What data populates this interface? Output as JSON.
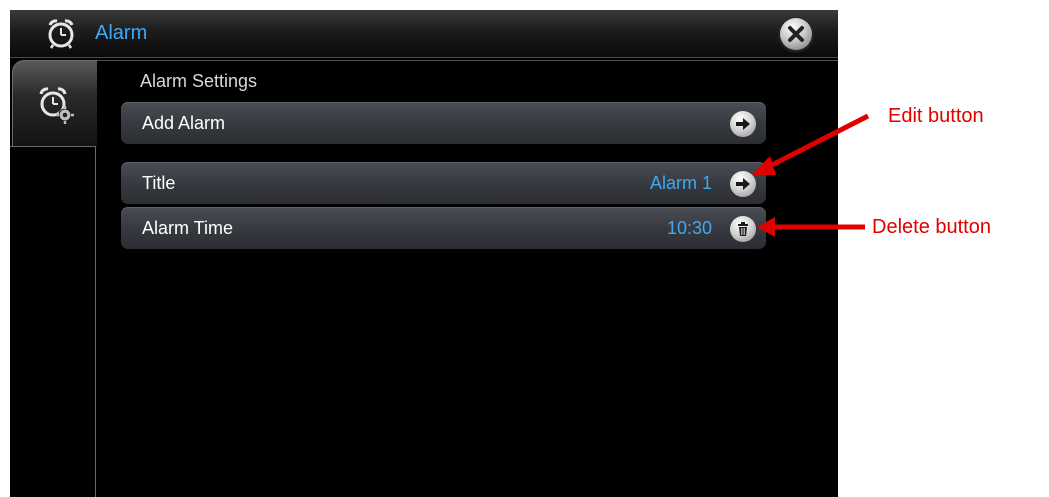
{
  "window": {
    "title": "Alarm",
    "title_icon": "alarm-clock-icon",
    "close_icon": "close-icon"
  },
  "sidebar": {
    "tab_icon": "alarm-settings-icon"
  },
  "main": {
    "section_title": "Alarm Settings",
    "rows": [
      {
        "label": "Add Alarm",
        "value": "",
        "action_icon": "arrow-right-icon"
      },
      {
        "label": "Title",
        "value": "Alarm 1",
        "action_icon": "arrow-right-icon"
      },
      {
        "label": "Alarm Time",
        "value": "10:30",
        "action_icon": "trash-icon"
      }
    ]
  },
  "annotations": {
    "edit_label": "Edit button",
    "delete_label": "Delete button"
  },
  "colors": {
    "accent": "#3fa9f5",
    "annotation": "#e00000",
    "background": "#000000"
  }
}
